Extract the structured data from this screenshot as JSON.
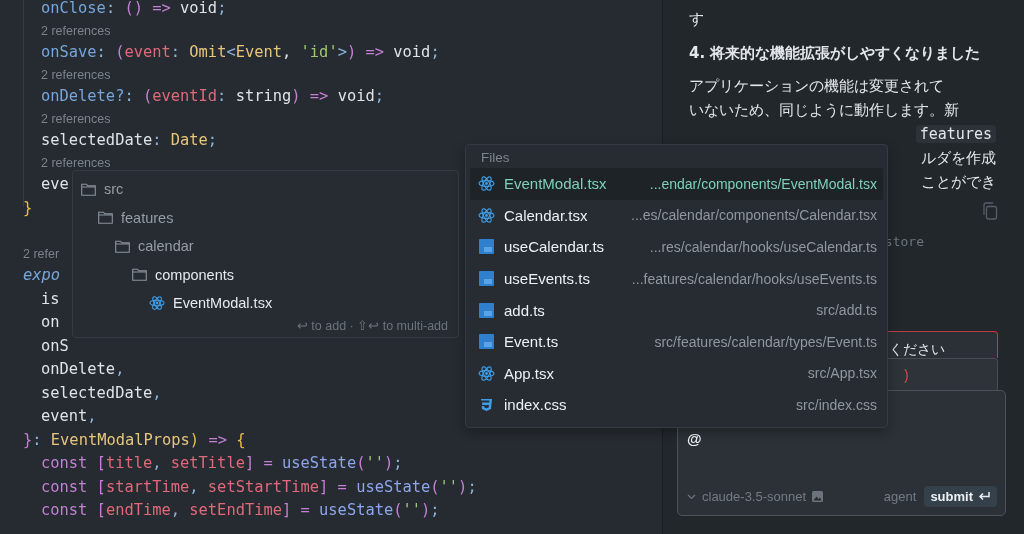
{
  "editor": {
    "lines": [
      {
        "kind": "code",
        "indented": true,
        "tokens": [
          {
            "text": "onClose",
            "kind": "prop"
          },
          {
            "text": ": ",
            "kind": "punct"
          },
          {
            "text": "()",
            "kind": "paren"
          },
          {
            "text": " => ",
            "kind": "kw"
          },
          {
            "text": "void",
            "kind": "plain"
          },
          {
            "text": ";",
            "kind": "punct"
          }
        ]
      },
      {
        "kind": "ref",
        "indented": true,
        "text": "2 references"
      },
      {
        "kind": "code",
        "indented": true,
        "tokens": [
          {
            "text": "onSave",
            "kind": "prop"
          },
          {
            "text": ": ",
            "kind": "punct"
          },
          {
            "text": "(",
            "kind": "paren"
          },
          {
            "text": "event",
            "kind": "param"
          },
          {
            "text": ": ",
            "kind": "punct"
          },
          {
            "text": "Omit",
            "kind": "type"
          },
          {
            "text": "<",
            "kind": "punct"
          },
          {
            "text": "Event",
            "kind": "type"
          },
          {
            "text": ", ",
            "kind": "plain"
          },
          {
            "text": "'id'",
            "kind": "str"
          },
          {
            "text": ">",
            "kind": "punct"
          },
          {
            "text": ")",
            "kind": "paren"
          },
          {
            "text": " => ",
            "kind": "kw"
          },
          {
            "text": "void",
            "kind": "plain"
          },
          {
            "text": ";",
            "kind": "punct"
          }
        ]
      },
      {
        "kind": "ref",
        "indented": true,
        "text": "2 references"
      },
      {
        "kind": "code",
        "indented": true,
        "tokens": [
          {
            "text": "onDelete?",
            "kind": "prop"
          },
          {
            "text": ": ",
            "kind": "punct"
          },
          {
            "text": "(",
            "kind": "paren"
          },
          {
            "text": "eventId",
            "kind": "param"
          },
          {
            "text": ": ",
            "kind": "punct"
          },
          {
            "text": "string",
            "kind": "plain"
          },
          {
            "text": ")",
            "kind": "paren"
          },
          {
            "text": " => ",
            "kind": "kw"
          },
          {
            "text": "void",
            "kind": "plain"
          },
          {
            "text": ";",
            "kind": "punct"
          }
        ]
      },
      {
        "kind": "ref",
        "indented": true,
        "text": "2 references"
      },
      {
        "kind": "code",
        "indented": true,
        "tokens": [
          {
            "text": "selectedDate",
            "kind": "plain"
          },
          {
            "text": ": ",
            "kind": "punct"
          },
          {
            "text": "Date",
            "kind": "type"
          },
          {
            "text": ";",
            "kind": "punct"
          }
        ]
      },
      {
        "kind": "ref",
        "indented": true,
        "text": "2 references"
      },
      {
        "kind": "code",
        "indented": true,
        "tokens": [
          {
            "text": "eve",
            "kind": "plain"
          }
        ]
      },
      {
        "kind": "code",
        "indented": false,
        "tokens": [
          {
            "text": "}",
            "kind": "brace"
          }
        ]
      },
      {
        "kind": "blank"
      },
      {
        "kind": "ref",
        "indented": false,
        "text": "2 refer"
      },
      {
        "kind": "code",
        "indented": false,
        "tokens": [
          {
            "text": "expo",
            "kind": "italic"
          }
        ]
      },
      {
        "kind": "code",
        "indented": true,
        "tokens": [
          {
            "text": "is",
            "kind": "plain"
          }
        ]
      },
      {
        "kind": "code",
        "indented": true,
        "tokens": [
          {
            "text": "on",
            "kind": "plain"
          }
        ]
      },
      {
        "kind": "code",
        "indented": true,
        "tokens": [
          {
            "text": "onS",
            "kind": "plain"
          }
        ]
      },
      {
        "kind": "code",
        "indented": true,
        "tokens": [
          {
            "text": "onDelete",
            "kind": "plain"
          },
          {
            "text": ",",
            "kind": "punct"
          }
        ]
      },
      {
        "kind": "code",
        "indented": true,
        "tokens": [
          {
            "text": "selectedDate",
            "kind": "plain"
          },
          {
            "text": ",",
            "kind": "punct"
          }
        ]
      },
      {
        "kind": "code",
        "indented": true,
        "tokens": [
          {
            "text": "event",
            "kind": "plain"
          },
          {
            "text": ",",
            "kind": "punct"
          }
        ]
      },
      {
        "kind": "code",
        "indented": false,
        "tokens": [
          {
            "text": "}",
            "kind": "paren"
          },
          {
            "text": ": ",
            "kind": "punct"
          },
          {
            "text": "EventModalProps",
            "kind": "type"
          },
          {
            "text": ")",
            "kind": "brace"
          },
          {
            "text": " => ",
            "kind": "kw"
          },
          {
            "text": "{",
            "kind": "brace"
          }
        ]
      },
      {
        "kind": "code",
        "indented": true,
        "tokens": [
          {
            "text": "const ",
            "kind": "kw"
          },
          {
            "text": "[",
            "kind": "paren"
          },
          {
            "text": "title",
            "kind": "param"
          },
          {
            "text": ", ",
            "kind": "punct"
          },
          {
            "text": "setTitle",
            "kind": "param"
          },
          {
            "text": "]",
            "kind": "paren"
          },
          {
            "text": " = ",
            "kind": "kw"
          },
          {
            "text": "useState",
            "kind": "fn"
          },
          {
            "text": "(",
            "kind": "paren"
          },
          {
            "text": "''",
            "kind": "str"
          },
          {
            "text": ")",
            "kind": "paren"
          },
          {
            "text": ";",
            "kind": "punct"
          }
        ]
      },
      {
        "kind": "code",
        "indented": true,
        "tokens": [
          {
            "text": "const ",
            "kind": "kw"
          },
          {
            "text": "[",
            "kind": "paren"
          },
          {
            "text": "startTime",
            "kind": "param"
          },
          {
            "text": ", ",
            "kind": "punct"
          },
          {
            "text": "setStartTime",
            "kind": "param"
          },
          {
            "text": "]",
            "kind": "paren"
          },
          {
            "text": " = ",
            "kind": "kw"
          },
          {
            "text": "useState",
            "kind": "fn"
          },
          {
            "text": "(",
            "kind": "paren"
          },
          {
            "text": "''",
            "kind": "str"
          },
          {
            "text": ")",
            "kind": "paren"
          },
          {
            "text": ";",
            "kind": "punct"
          }
        ]
      },
      {
        "kind": "code",
        "indented": true,
        "tokens": [
          {
            "text": "const ",
            "kind": "kw"
          },
          {
            "text": "[",
            "kind": "paren"
          },
          {
            "text": "endTime",
            "kind": "param"
          },
          {
            "text": ", ",
            "kind": "punct"
          },
          {
            "text": "setEndTime",
            "kind": "param"
          },
          {
            "text": "]",
            "kind": "paren"
          },
          {
            "text": " = ",
            "kind": "kw"
          },
          {
            "text": "useState",
            "kind": "fn"
          },
          {
            "text": "(",
            "kind": "paren"
          },
          {
            "text": "''",
            "kind": "str"
          },
          {
            "text": ")",
            "kind": "paren"
          },
          {
            "text": ";",
            "kind": "punct"
          }
        ]
      }
    ]
  },
  "folder_popup": {
    "tree": [
      {
        "label": "src",
        "kind": "folder",
        "children": [
          {
            "label": "features",
            "kind": "folder",
            "children": [
              {
                "label": "calendar",
                "kind": "folder",
                "children": [
                  {
                    "label": "components",
                    "kind": "folder",
                    "children": [
                      {
                        "label": "EventModal.tsx",
                        "kind": "react"
                      }
                    ]
                  }
                ]
              }
            ]
          }
        ]
      }
    ],
    "hint": "↩ to add · ⇧↩ to multi-add"
  },
  "files_popup": {
    "header": "Files",
    "items": [
      {
        "name": "EventModal.tsx",
        "path": "...endar/components/EventModal.tsx",
        "kind": "react",
        "selected": true
      },
      {
        "name": "Calendar.tsx",
        "path": "...es/calendar/components/Calendar.tsx",
        "kind": "react",
        "selected": false
      },
      {
        "name": "useCalendar.ts",
        "path": "...res/calendar/hooks/useCalendar.ts",
        "kind": "ts",
        "selected": false
      },
      {
        "name": "useEvents.ts",
        "path": "...features/calendar/hooks/useEvents.ts",
        "kind": "ts",
        "selected": false
      },
      {
        "name": "add.ts",
        "path": "src/add.ts",
        "kind": "ts",
        "selected": false
      },
      {
        "name": "Event.ts",
        "path": "src/features/calendar/types/Event.ts",
        "kind": "ts",
        "selected": false
      },
      {
        "name": "App.tsx",
        "path": "src/App.tsx",
        "kind": "react",
        "selected": false
      },
      {
        "name": "index.css",
        "path": "src/index.css",
        "kind": "css",
        "selected": false
      }
    ]
  },
  "chat": {
    "tail": "す",
    "heading": "4. 将来的な機能拡張がしやすくなりました",
    "paragraph_lines": [
      {
        "text": "アプリケーションの機能は変更されて",
        "kind": "text"
      },
      {
        "text": "いないため、同じように動作します。新",
        "kind": "text"
      },
      {
        "text": "features",
        "kind": "code"
      },
      {
        "text": "ルダを作成",
        "kind": "text"
      },
      {
        "text": "ことができ",
        "kind": "text"
      }
    ],
    "store_fragment": "store",
    "error_fragment": "ください",
    "paren_fragment": ")",
    "input": {
      "value": "@",
      "model": "claude-3.5-sonnet",
      "mode": "agent",
      "submit": "submit"
    }
  }
}
